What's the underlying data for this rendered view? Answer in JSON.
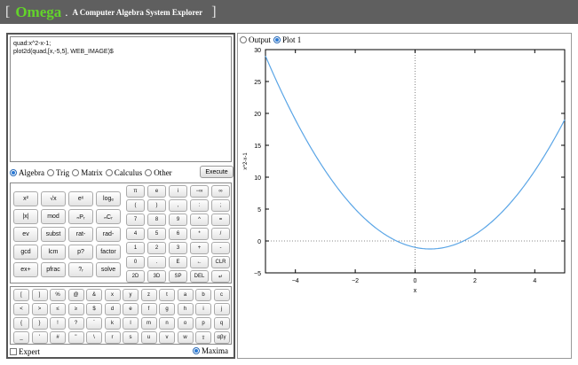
{
  "title": {
    "bracket_open": "[",
    "name": "Omega",
    "dot": ".",
    "subtitle": "A Computer Algebra System Explorer",
    "bracket_close": "]"
  },
  "editor": {
    "text": "quad:x^2-x-1;\nplot2d(quad,[x,-5,5], WEB_IMAGE)$"
  },
  "categories": [
    {
      "label": "Algebra",
      "selected": true
    },
    {
      "label": "Trig",
      "selected": false
    },
    {
      "label": "Matrix",
      "selected": false
    },
    {
      "label": "Calculus",
      "selected": false
    },
    {
      "label": "Other",
      "selected": false
    }
  ],
  "execute_label": "Execute",
  "functions": [
    [
      "x²",
      "√x",
      "eˣ",
      "logₑ"
    ],
    [
      "|x|",
      "mod",
      "ₙPᵣ",
      "ₙCᵣ"
    ],
    [
      "ev",
      "subst",
      "rat-",
      "rad-"
    ],
    [
      "gcd",
      "lcm",
      "p?",
      "factor"
    ],
    [
      "ex+",
      "pfrac",
      "?ᵣ",
      "solve"
    ]
  ],
  "keypad": [
    [
      "π",
      "e",
      "i",
      "−∞",
      "∞"
    ],
    [
      "(",
      ")",
      ",",
      ":",
      ";"
    ],
    [
      "7",
      "8",
      "9",
      "^",
      "="
    ],
    [
      "4",
      "5",
      "6",
      "*",
      "/"
    ],
    [
      "1",
      "2",
      "3",
      "+",
      "-"
    ],
    [
      "0",
      ".",
      "E",
      "←",
      "CLR"
    ],
    [
      "2D",
      "3D",
      "SP",
      "DEL",
      "↵"
    ]
  ],
  "symbols": [
    [
      "[",
      "]",
      "%",
      "@",
      "&",
      "x",
      "y",
      "z",
      "t",
      "a",
      "b",
      "c"
    ],
    [
      "<",
      ">",
      "≤",
      "≥",
      "$",
      "d",
      "e",
      "f",
      "g",
      "h",
      "i",
      "j"
    ],
    [
      "{",
      "}",
      "!",
      "?",
      "`",
      "k",
      "l",
      "m",
      "n",
      "o",
      "p",
      "q"
    ],
    [
      "_",
      "'",
      "#",
      "\"",
      "\\",
      "r",
      "s",
      "u",
      "v",
      "w",
      "⇧",
      "αβγ"
    ]
  ],
  "expert_label": "Expert",
  "engine_label": "Maxima",
  "output_tabs": [
    {
      "label": "Output",
      "selected": false
    },
    {
      "label": "Plot 1",
      "selected": true
    }
  ],
  "chart_data": {
    "type": "line",
    "function": "x^2-x-1",
    "xlabel": "x",
    "ylabel": "x^2-x-1",
    "xlim": [
      -5,
      5
    ],
    "ylim": [
      -5,
      30
    ],
    "x_ticks": [
      -4,
      -2,
      0,
      2,
      4
    ],
    "y_ticks": [
      -5,
      0,
      5,
      10,
      15,
      20,
      25,
      30
    ],
    "x_tick_labels": [
      "−4",
      "−2",
      "0",
      "2",
      "4"
    ],
    "y_tick_labels": [
      "−5",
      "0",
      "5",
      "10",
      "15",
      "20",
      "25",
      "30"
    ],
    "line_color": "#5aa5e6",
    "zero_lines": "dotted"
  }
}
